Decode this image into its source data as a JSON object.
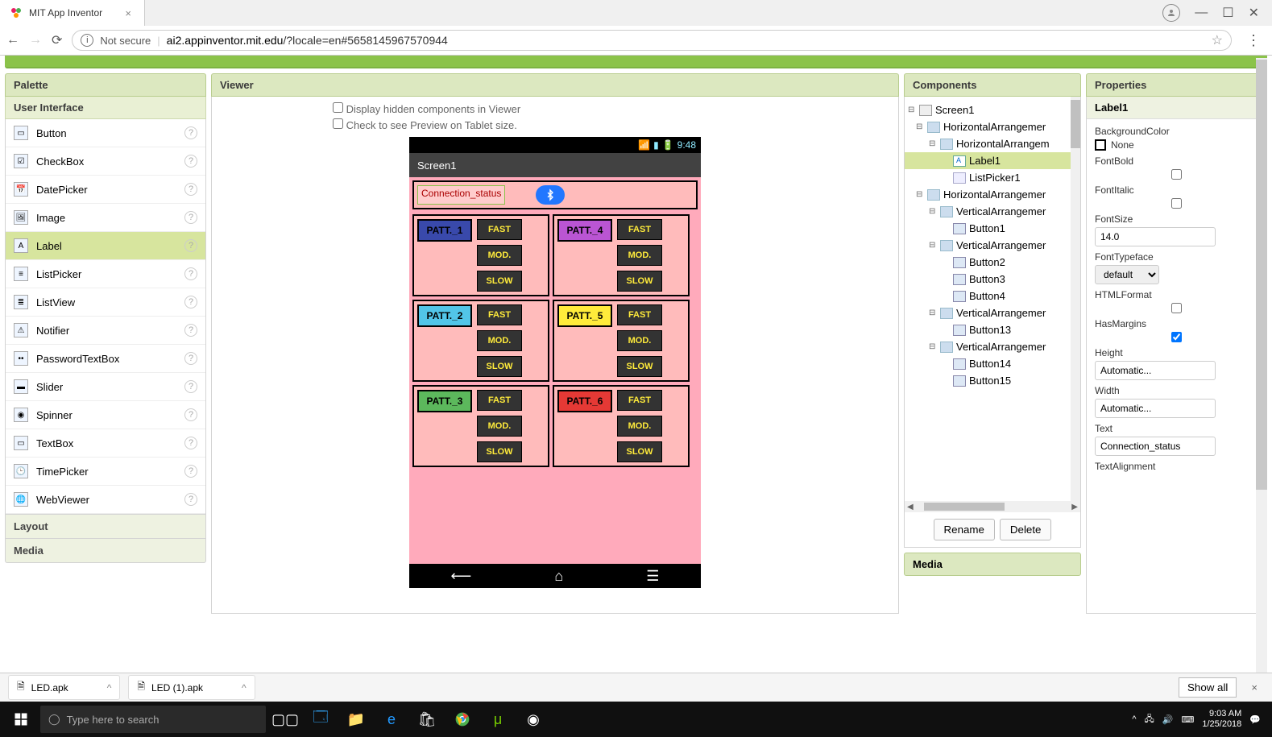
{
  "browser": {
    "tab_title": "MIT App Inventor",
    "not_secure": "Not secure",
    "url_host": "ai2.appinventor.mit.edu",
    "url_path": "/?locale=en#5658145967570944"
  },
  "palette": {
    "title": "Palette",
    "category": "User Interface",
    "items": [
      "Button",
      "CheckBox",
      "DatePicker",
      "Image",
      "Label",
      "ListPicker",
      "ListView",
      "Notifier",
      "PasswordTextBox",
      "Slider",
      "Spinner",
      "TextBox",
      "TimePicker",
      "WebViewer"
    ],
    "selected": "Label",
    "cat_layout": "Layout",
    "cat_media": "Media"
  },
  "viewer": {
    "title": "Viewer",
    "opt_hidden": "Display hidden components in Viewer",
    "opt_tablet": "Check to see Preview on Tablet size.",
    "clock": "9:48",
    "screen": "Screen1",
    "conn_status": "Connection_status",
    "patt": [
      "PATT._1",
      "PATT._2",
      "PATT._3",
      "PATT._4",
      "PATT._5",
      "PATT._6"
    ],
    "patt_colors": [
      "#3949ab",
      "#52c5e8",
      "#5cb85c",
      "#ba55d3",
      "#ffeb3b",
      "#e53935"
    ],
    "fast": "FAST",
    "mod": "MOD.",
    "slow": "SLOW"
  },
  "components": {
    "title": "Components",
    "tree": [
      {
        "ind": 0,
        "exp": "⊟",
        "icon": "screen",
        "label": "Screen1"
      },
      {
        "ind": 1,
        "exp": "⊟",
        "icon": "harr",
        "label": "HorizontalArrangemer"
      },
      {
        "ind": 2,
        "exp": "⊟",
        "icon": "harr",
        "label": "HorizontalArrangem"
      },
      {
        "ind": 3,
        "exp": "",
        "icon": "label",
        "label": "Label1",
        "selected": true
      },
      {
        "ind": 3,
        "exp": "",
        "icon": "list",
        "label": "ListPicker1"
      },
      {
        "ind": 1,
        "exp": "⊟",
        "icon": "harr",
        "label": "HorizontalArrangemer"
      },
      {
        "ind": 2,
        "exp": "⊟",
        "icon": "varr",
        "label": "VerticalArrangemer"
      },
      {
        "ind": 3,
        "exp": "",
        "icon": "btn",
        "label": "Button1"
      },
      {
        "ind": 2,
        "exp": "⊟",
        "icon": "varr",
        "label": "VerticalArrangemer"
      },
      {
        "ind": 3,
        "exp": "",
        "icon": "btn",
        "label": "Button2"
      },
      {
        "ind": 3,
        "exp": "",
        "icon": "btn",
        "label": "Button3"
      },
      {
        "ind": 3,
        "exp": "",
        "icon": "btn",
        "label": "Button4"
      },
      {
        "ind": 2,
        "exp": "⊟",
        "icon": "varr",
        "label": "VerticalArrangemer"
      },
      {
        "ind": 3,
        "exp": "",
        "icon": "btn",
        "label": "Button13"
      },
      {
        "ind": 2,
        "exp": "⊟",
        "icon": "varr",
        "label": "VerticalArrangemer"
      },
      {
        "ind": 3,
        "exp": "",
        "icon": "btn",
        "label": "Button14"
      },
      {
        "ind": 3,
        "exp": "",
        "icon": "btn",
        "label": "Button15"
      }
    ],
    "rename": "Rename",
    "delete": "Delete",
    "media": "Media"
  },
  "properties": {
    "title": "Properties",
    "component": "Label1",
    "bgcolor_label": "BackgroundColor",
    "bgcolor_value": "None",
    "fontbold": "FontBold",
    "fontitalic": "FontItalic",
    "fontsize_label": "FontSize",
    "fontsize_value": "14.0",
    "typeface_label": "FontTypeface",
    "typeface_value": "default",
    "htmlformat": "HTMLFormat",
    "hasmargins": "HasMargins",
    "height_label": "Height",
    "height_value": "Automatic...",
    "width_label": "Width",
    "width_value": "Automatic...",
    "text_label": "Text",
    "text_value": "Connection_status",
    "textalign_label": "TextAlignment"
  },
  "downloads": {
    "file1": "LED.apk",
    "file2": "LED (1).apk",
    "showall": "Show all"
  },
  "taskbar": {
    "search_placeholder": "Type here to search",
    "time": "9:03 AM",
    "date": "1/25/2018"
  }
}
